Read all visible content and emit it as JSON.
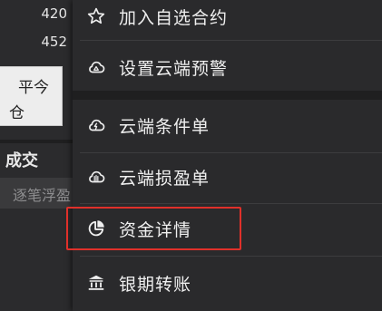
{
  "background_panel": {
    "price_1": "420",
    "price_2": "452",
    "button_line_1": "平今",
    "button_line_2": "仓",
    "deal_label": "成交",
    "tab_label": "逐笔浮盈"
  },
  "menu": {
    "items": [
      {
        "label": "加入自选合约",
        "icon": "star-outline-icon"
      },
      {
        "label": "设置云端预警",
        "icon": "cloud-alert-icon"
      },
      {
        "label": "云端条件单",
        "icon": "cloud-lightning-icon"
      },
      {
        "label": "云端损盈单",
        "icon": "cloud-stop-icon"
      },
      {
        "label": "资金详情",
        "icon": "pie-chart-icon"
      },
      {
        "label": "银期转账",
        "icon": "bank-icon"
      }
    ]
  },
  "highlight_color": "#e0302a"
}
